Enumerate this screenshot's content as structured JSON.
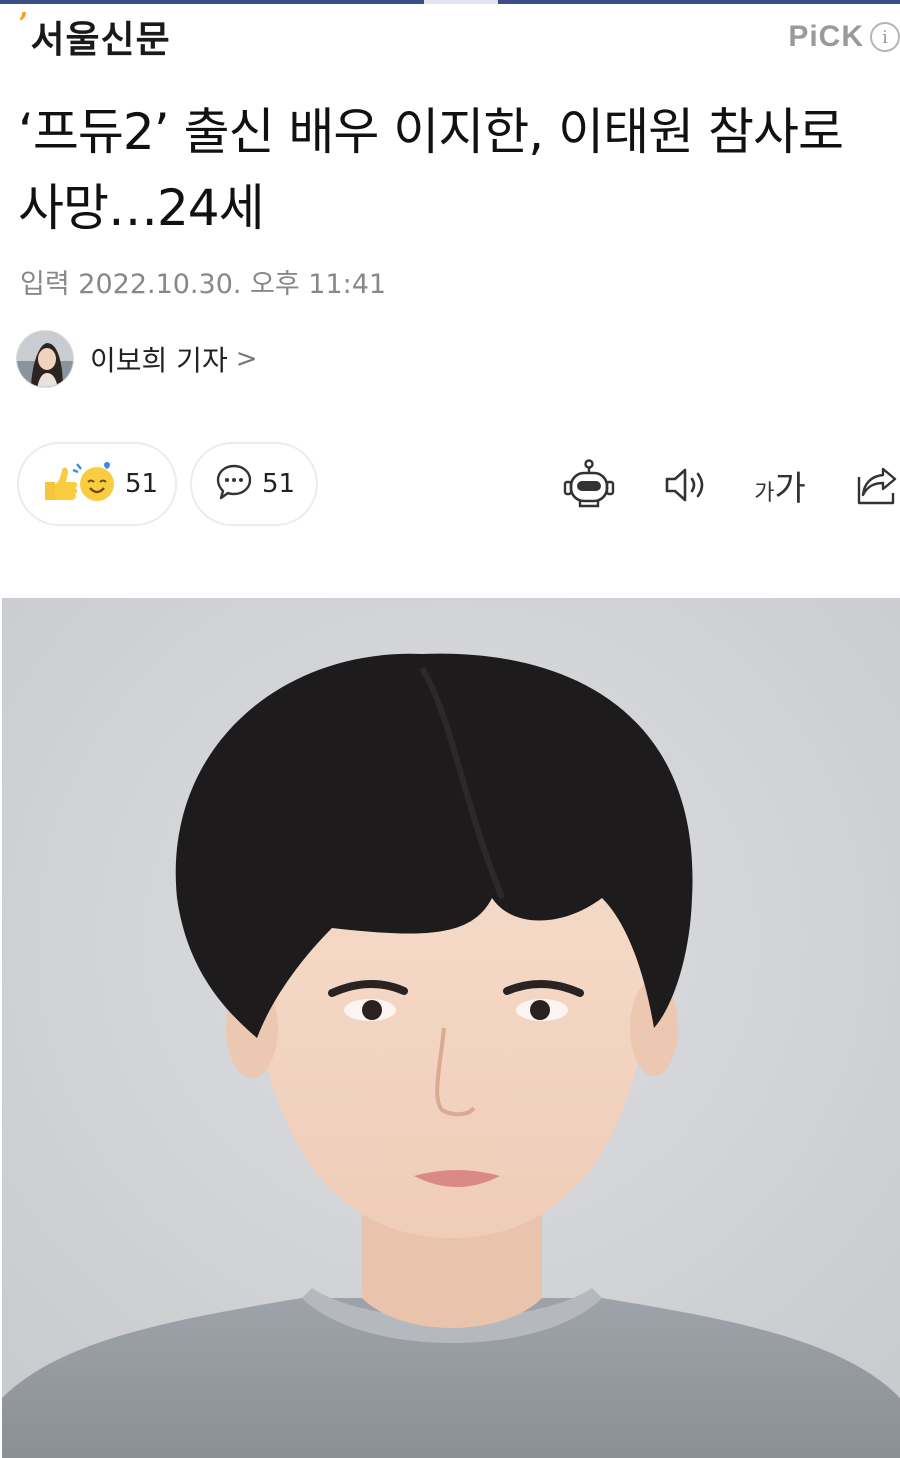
{
  "press": {
    "name": "서울신문"
  },
  "pick": {
    "label": "PiCK",
    "info_glyph": "i"
  },
  "article": {
    "headline": "‘프듀2’ 출신 배우 이지한, 이태원 참사로 사망…24세",
    "timestamp_label": "입력",
    "timestamp": "2022.10.30. 오후 11:41"
  },
  "reporter": {
    "name": "이보희 기자",
    "chevron": ">"
  },
  "actions": {
    "reaction_count": "51",
    "comment_count": "51",
    "font_size_small": "가",
    "font_size_large": "가"
  },
  "icons": {
    "reaction": "reaction-emoji-icon",
    "comment": "comment-bubble-icon",
    "summary_bot": "robot-icon",
    "listen": "speaker-icon",
    "font_size": "font-size-icon",
    "share": "share-icon"
  },
  "colors": {
    "accent_bar": "#3a4e86",
    "press_tick": "#f5a623"
  }
}
